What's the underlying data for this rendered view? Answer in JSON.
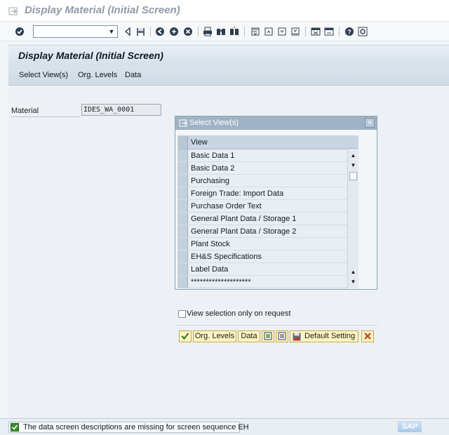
{
  "window": {
    "title": "Display Material (Initial Screen)"
  },
  "toolbar": {
    "command_field_value": "",
    "icons": [
      "enter-icon",
      "command-dropdown-icon",
      "back-icon",
      "save-icon",
      "back-arrow-icon",
      "exit-icon",
      "cancel-icon",
      "print-icon",
      "find-icon",
      "find-next-icon",
      "first-page-icon",
      "previous-page-icon",
      "next-page-icon",
      "last-page-icon",
      "new-session-icon",
      "shortcut-icon",
      "help-icon",
      "layout-menu-icon"
    ]
  },
  "screen": {
    "title": "Display Material (Initial Screen)",
    "menu": [
      "Select View(s)",
      "Org. Levels",
      "Data"
    ]
  },
  "material": {
    "label": "Material",
    "value": "IDES_WA_0001"
  },
  "dialog": {
    "title": "Select View(s)",
    "close_label": "×",
    "column_header": "View",
    "rows": [
      "Basic Data 1",
      "Basic Data 2",
      "Purchasing",
      "Foreign Trade: Import Data",
      "Purchase Order Text",
      "General Plant Data / Storage 1",
      "General Plant Data / Storage 2",
      "Plant Stock",
      "EH&S Specifications",
      "Label Data",
      "********************"
    ],
    "checkbox_label": "View selection only on request",
    "checkbox_checked": false,
    "buttons": {
      "org_levels": "Org. Levels",
      "data": "Data",
      "default_setting": "Default Setting"
    }
  },
  "status": {
    "message": "The data screen descriptions are missing for screen sequence EH",
    "type": "success"
  },
  "branding": {
    "logo": "SAP"
  },
  "colors": {
    "accent": "#9fb3c7",
    "button_bg": "#fff4c2",
    "ok_green": "#3a8a2f",
    "cancel_red": "#c0392b"
  }
}
